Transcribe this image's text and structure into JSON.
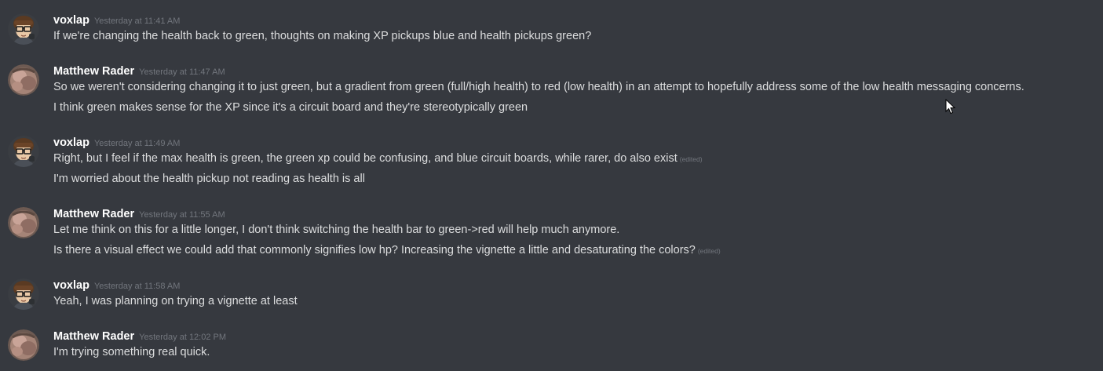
{
  "messages": [
    {
      "author": "voxlap",
      "timestamp": "Yesterday at 11:41 AM",
      "lines": [
        {
          "text": "If we're changing the health back to green, thoughts on making XP pickups blue and health pickups green?",
          "edited": ""
        }
      ]
    },
    {
      "author": "Matthew Rader",
      "timestamp": "Yesterday at 11:47 AM",
      "lines": [
        {
          "text": "So we weren't considering changing it to just green, but a gradient from green (full/high health) to red (low health) in an attempt to hopefully address some of the low health messaging concerns.",
          "edited": ""
        },
        {
          "text": "I think green makes sense for the XP since it's a circuit board and they're stereotypically green",
          "edited": ""
        }
      ]
    },
    {
      "author": "voxlap",
      "timestamp": "Yesterday at 11:49 AM",
      "lines": [
        {
          "text": "Right, but I feel if the max health is green, the green xp could be confusing, and blue circuit boards, while rarer, do also exist",
          "edited": "(edited)"
        },
        {
          "text": "I'm worried about the health pickup not reading as health is all",
          "edited": ""
        }
      ]
    },
    {
      "author": "Matthew Rader",
      "timestamp": "Yesterday at 11:55 AM",
      "lines": [
        {
          "text": "Let me think on this for a little longer, I don't think switching the health bar to green->red will help much anymore.",
          "edited": ""
        },
        {
          "text": "Is there a visual effect we could add that commonly signifies low hp? Increasing the vignette a little and desaturating the colors?",
          "edited": "(edited)"
        }
      ]
    },
    {
      "author": "voxlap",
      "timestamp": "Yesterday at 11:58 AM",
      "lines": [
        {
          "text": "Yeah, I was planning on trying a vignette at least",
          "edited": ""
        }
      ]
    },
    {
      "author": "Matthew Rader",
      "timestamp": "Yesterday at 12:02 PM",
      "lines": [
        {
          "text": "I'm trying something real quick.",
          "edited": ""
        }
      ]
    }
  ],
  "colors": {
    "background": "#36393f",
    "username": "#ffffff",
    "message_text": "#dcddde",
    "timestamp": "#72767d"
  }
}
